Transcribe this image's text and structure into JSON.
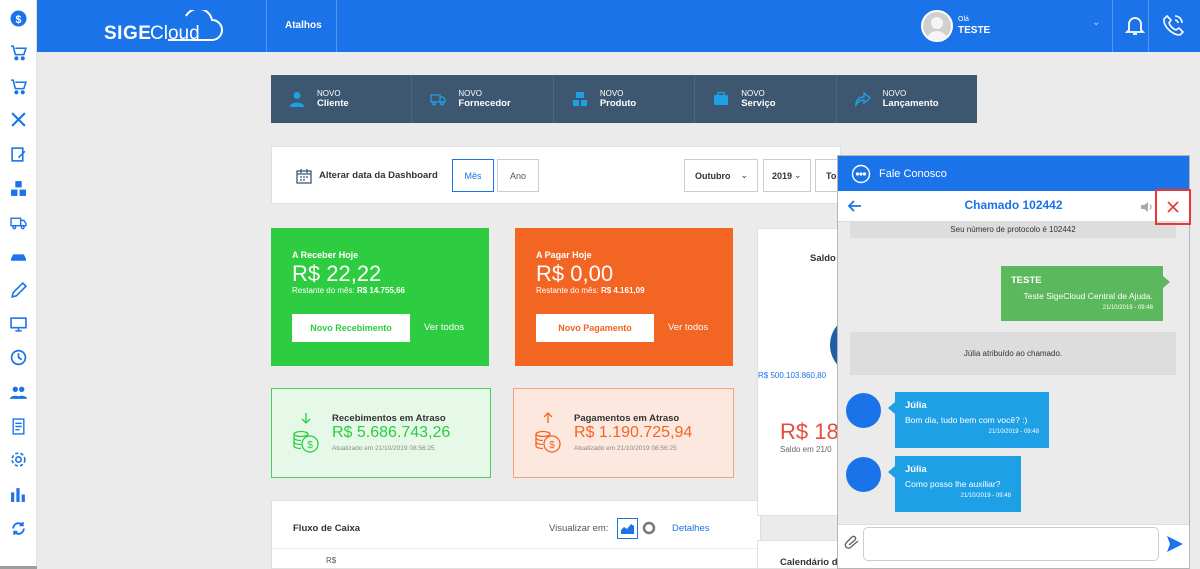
{
  "brand": {
    "logo_bold": "SIGE",
    "logo_light": "Cloud"
  },
  "topbar": {
    "atalhos": "Atalhos",
    "greeting": "Olá",
    "username": "TESTE",
    "chevron": "⌄"
  },
  "shortcuts": [
    {
      "sub": "NOVO",
      "main": "Cliente"
    },
    {
      "sub": "NOVO",
      "main": "Fornecedor"
    },
    {
      "sub": "NOVO",
      "main": "Produto"
    },
    {
      "sub": "NOVO",
      "main": "Serviço"
    },
    {
      "sub": "NOVO",
      "main": "Lançamento"
    }
  ],
  "datebar": {
    "label": "Alterar data da Dashboard",
    "btn_mes": "Mês",
    "btn_ano": "Ano",
    "month": "Outubro",
    "year": "2019",
    "extra": "To"
  },
  "receber": {
    "title": "A Receber Hoje",
    "amount": "R$ 22,22",
    "rest_label": "Restante do mês:",
    "rest_value": "R$ 14.755,66",
    "button": "Novo Recebimento",
    "link": "Ver todos"
  },
  "pagar": {
    "title": "A Pagar Hoje",
    "amount": "R$ 0,00",
    "rest_label": "Restante do mês:",
    "rest_value": "R$ 4.161,09",
    "button": "Novo Pagamento",
    "link": "Ver todos"
  },
  "rec_atraso": {
    "title": "Recebimentos em Atraso",
    "amount": "R$ 5.686.743,26",
    "updated": "Atualizado em 21/10/2019 08:56:25"
  },
  "pag_atraso": {
    "title": "Pagamentos em Atraso",
    "amount": "R$ 1.190.725,94",
    "updated": "Atualizado em 21/10/2019 08:56:25"
  },
  "fluxo": {
    "title": "Fluxo de Caixa",
    "visualizar": "Visualizar em:",
    "detalhes": "Detalhes",
    "axis_label": "R$"
  },
  "saldo": {
    "title": "Saldo",
    "value": "R$ 500.103.860,80",
    "big": "R$ 18",
    "sub": "Saldo em 21/0"
  },
  "calendario": {
    "title": "Calendário d"
  },
  "chat": {
    "header": "Fale Conosco",
    "ticket": "Chamado 102442",
    "system1": "Seu número de protocolo é 102442",
    "out_name": "TESTE",
    "out_msg": "Teste SigeCloud Central de Ajuda.",
    "out_time": "21/10/2019 - 09:48",
    "system2": "Júlia atribuído ao chamado.",
    "in1_name": "Júlia",
    "in1_msg": "Bom dia, tudo bem com você? :)",
    "in1_time": "21/10/2019 - 09:48",
    "in2_name": "Júlia",
    "in2_msg": "Como posso lhe auxiliar?",
    "in2_time": "21/10/2019 - 09:48",
    "input_value": ""
  },
  "colors": {
    "primary": "#1a73e8",
    "green": "#2ecc40",
    "orange": "#f26522",
    "navy": "#3e5770"
  }
}
